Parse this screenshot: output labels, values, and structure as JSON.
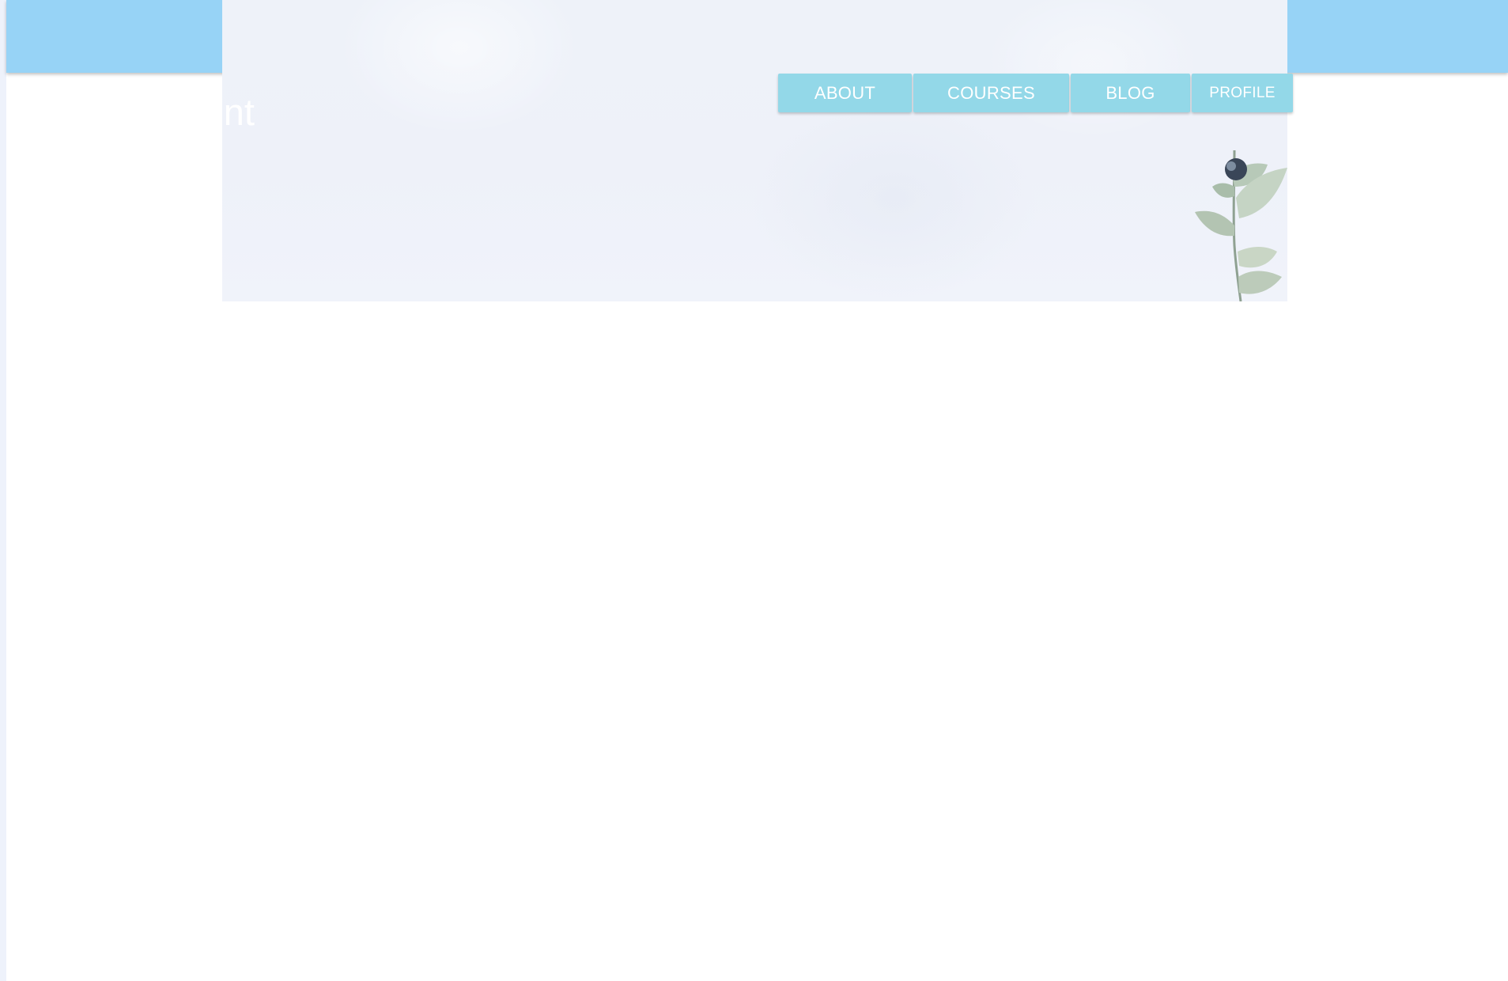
{
  "brand": {
    "partial_title": "nt"
  },
  "nav": {
    "items": [
      {
        "label": "ABOUT"
      },
      {
        "label": "COURSES"
      },
      {
        "label": "BLOG"
      },
      {
        "label": "PROFILE"
      }
    ]
  },
  "colors": {
    "topbar": "#97d3f6",
    "nav_button": "#93d8e8",
    "hero_background": "#eef2f9",
    "page_background": "#ffffff"
  },
  "icons": {
    "hero_decoration": "eucalyptus-plant"
  }
}
